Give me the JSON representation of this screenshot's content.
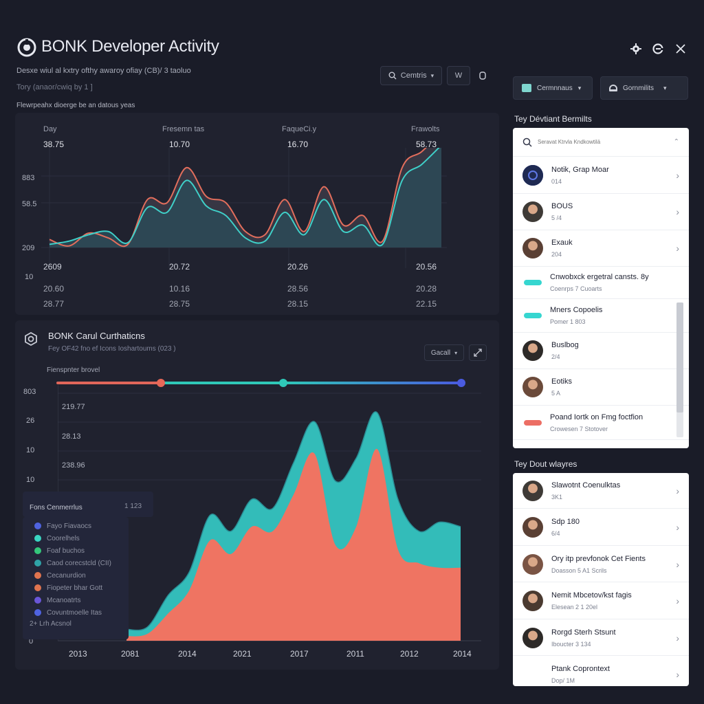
{
  "header": {
    "title": "BONK Developer Activity",
    "subtitle1": "Desxe wiul al kxtry ofthy awaroy ofiay (CB)/ 3 taoluo",
    "subtitle2": "Tory (anaor/cwiq by 1 ]",
    "subtitle3": "Flewrpeahx dioerge be an datous yeas",
    "toolbar": {
      "search_label": "Cemtris",
      "filter_label": "W",
      "dropdown1_label": "Cermnnaus",
      "dropdown2_label": "Gornmilits"
    }
  },
  "top_panel": {
    "columns": [
      {
        "head": "Day",
        "val": "38.75"
      },
      {
        "head": "Fresemn tas",
        "val": "10.70"
      },
      {
        "head": "FaqueCi.y",
        "val": "16.70"
      },
      {
        "head": "Frawolts",
        "val": "58.73"
      }
    ],
    "y_ticks": [
      "883",
      "58.5",
      "209",
      "10"
    ],
    "footer_rows": [
      [
        "2609",
        "20.72",
        "20.26",
        "20.56"
      ],
      [
        "20.60",
        "10.16",
        "28.56",
        "20.28"
      ],
      [
        "28.77",
        "28.75",
        "28.15",
        "22.15"
      ]
    ]
  },
  "bottom_panel": {
    "title": "BONK Carul  Curthaticns",
    "subtitle": "Fey OF42 fno ef Icons Ioshartoums (023 )",
    "dropdown_label": "Gacall",
    "slider_label": "Fienspnter brovel",
    "y_ticks": [
      "803",
      "26",
      "10",
      "10",
      "0"
    ],
    "inner_labels": [
      "219.77",
      "28.13",
      "238.96"
    ],
    "x_ticks": [
      "2013",
      "2081",
      "2014",
      "2021",
      "2017",
      "2011",
      "2012",
      "2014"
    ],
    "legend": {
      "title": "Fons Cenmerrlus",
      "value": "1 123",
      "items": [
        {
          "label": "Fayo Fiavaocs",
          "color": "#4f63e0"
        },
        {
          "label": "Coorelhels",
          "color": "#3ad6c2"
        },
        {
          "label": "Foaf buchos",
          "color": "#34c77b"
        },
        {
          "label": "Caod corecstcld (CII)",
          "color": "#2fa3a8"
        },
        {
          "label": "Cecanurdion",
          "color": "#e0744f"
        },
        {
          "label": "Fiopeter bhar Gott",
          "color": "#e0744f"
        },
        {
          "label": "Mcanoatrts",
          "color": "#6a56d8"
        },
        {
          "label": "Covuntmoelle Itas",
          "color": "#4f63e0"
        }
      ],
      "footer": "2+ Lrh Acsnol"
    }
  },
  "chart_data": [
    {
      "type": "line",
      "x": [
        0,
        1,
        2,
        3,
        4,
        5,
        6,
        7,
        8,
        9,
        10,
        11,
        12,
        13,
        14,
        15,
        16,
        17,
        18,
        19,
        20
      ],
      "series": [
        {
          "values": [
            5,
            1,
            9,
            6,
            2,
            30,
            28,
            50,
            32,
            28,
            10,
            8,
            30,
            10,
            38,
            14,
            20,
            4,
            50,
            60,
            72
          ]
        },
        {
          "values": [
            2,
            4,
            8,
            10,
            3,
            25,
            22,
            42,
            26,
            20,
            6,
            4,
            22,
            8,
            30,
            10,
            14,
            2,
            42,
            52,
            64
          ]
        }
      ],
      "ylim": [
        0,
        100
      ]
    },
    {
      "type": "area",
      "x": [
        0,
        1,
        2,
        3,
        4,
        5,
        6,
        7,
        8,
        9,
        10,
        11,
        12,
        13,
        14,
        15,
        16
      ],
      "series": [
        {
          "values": [
            5,
            6,
            20,
            30,
            55,
            48,
            62,
            58,
            78,
            96,
            70,
            80,
            100,
            62,
            48,
            52,
            50
          ]
        },
        {
          "values": [
            2,
            3,
            12,
            22,
            44,
            38,
            50,
            48,
            64,
            82,
            42,
            50,
            84,
            40,
            34,
            32,
            32
          ]
        }
      ],
      "ylim": [
        0,
        100
      ]
    }
  ],
  "right_panel": {
    "section1_title": "Tey Dévtiant Bermilts",
    "search_placeholder": "Seravat Ktrvla Kndkowtilä",
    "list1": [
      {
        "t1": "Notik, Grap Moar",
        "t2": "014",
        "kind": "logo"
      },
      {
        "t1": "BOUS",
        "t2": "5 /4",
        "kind": "avatar"
      },
      {
        "t1": "Exauk",
        "t2": "204",
        "kind": "avatar"
      },
      {
        "t1": "Cnwobxck ergetral cansts. 8y",
        "t2": "Coenrps 7 Cuoarts",
        "kind": "pill",
        "color": "#36d6d0"
      },
      {
        "t1": "Mners Copoelis",
        "t2": "Pomer 1 803",
        "kind": "pill",
        "color": "#36d6d0"
      },
      {
        "t1": "Buslbog",
        "t2": "2/4",
        "kind": "avatar"
      },
      {
        "t1": "Eotiks",
        "t2": "5 A",
        "kind": "avatar"
      },
      {
        "t1": "Poand Iortk on Fmg foctfion",
        "t2": "Crowesen 7 Stotover",
        "kind": "pill",
        "color": "#ec6e64"
      }
    ],
    "section2_title": "Tey Dout wlayres",
    "list2": [
      {
        "t1": "Slawotnt Coenulktas",
        "t2": "3K1"
      },
      {
        "t1": "Sdp 180",
        "t2": "6/4"
      },
      {
        "t1": "Ory itp prevfonok Cet Fients",
        "t2": "Doasson 5 A1 Scrils"
      },
      {
        "t1": "Nemit Mbcetov/kst fagis",
        "t2": "Elesean 2 1 20el"
      },
      {
        "t1": "Rorgd Sterh Stsunt",
        "t2": "Iboucter 3 134"
      },
      {
        "t1": "Ptank Coprontext",
        "t2": "Dop/ 1M"
      }
    ]
  },
  "colors": {
    "bg": "#1a1c28",
    "panel": "#20222f",
    "teal": "#35c9c4",
    "coral": "#ef7462",
    "line_orange": "#e36e5c",
    "blue": "#4a5be0"
  }
}
